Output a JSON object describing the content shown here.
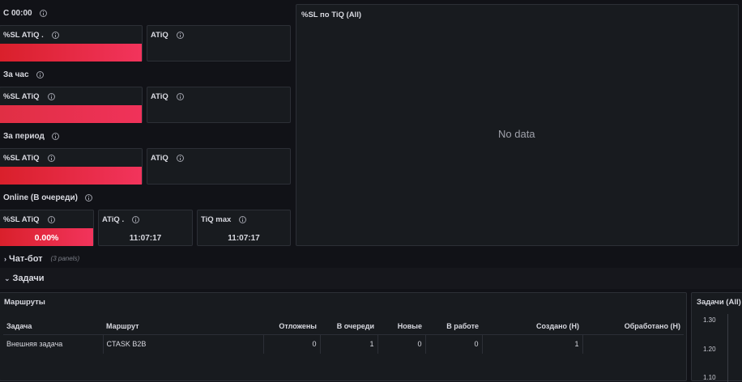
{
  "rows": {
    "since_midnight": "С 00:00",
    "per_hour": "За час",
    "per_period": "За период",
    "online": "Online (В очереди)"
  },
  "panels": {
    "p1_sl": "%SL ATiQ .",
    "p1_atiq": "ATiQ",
    "p2_sl": "%SL ATiQ",
    "p2_atiq": "ATiQ",
    "p3_sl": "%SL ATiQ",
    "p3_atiq": "ATiQ",
    "p4_sl": "%SL ATiQ",
    "p4_sl_value": "0.00%",
    "p4_atiq": "ATiQ .",
    "p4_atiq_value": "11:07:17",
    "p4_tiqmax": "TiQ max",
    "p4_tiqmax_value": "11:07:17"
  },
  "chart_panel": {
    "title": "%SL по TiQ (All)",
    "no_data": "No data"
  },
  "sections": {
    "chatbot": "Чат-бот",
    "chatbot_sub": "(3 panels)",
    "tasks": "Задачи"
  },
  "routes_table": {
    "title": "Маршруты",
    "headers": [
      "Задача",
      "Маршрут",
      "Отложены",
      "В очереди",
      "Новые",
      "В работе",
      "Создано (Н)",
      "Обработано (Н)"
    ],
    "rows": [
      [
        "Внешняя задача",
        "CTASK B2B",
        "0",
        "1",
        "0",
        "0",
        "1",
        ""
      ]
    ]
  },
  "tasks_chart": {
    "title": "Задачи (All)",
    "y_ticks": [
      "1.30",
      "1.20",
      "1.10"
    ]
  },
  "colors": {
    "background": "#111217",
    "panel": "#181b1f",
    "red": "#e02f44"
  }
}
